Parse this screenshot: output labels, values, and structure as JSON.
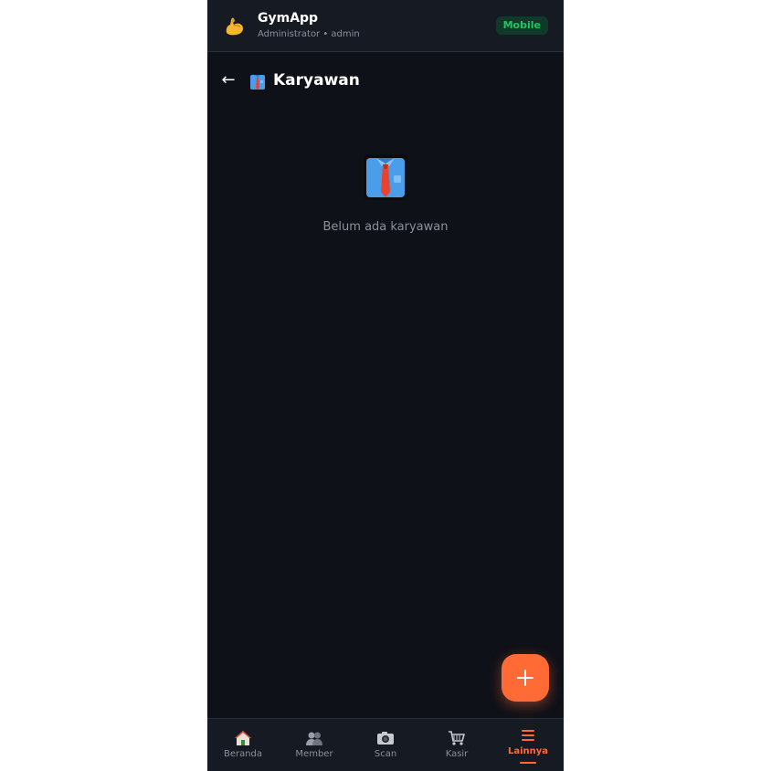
{
  "header": {
    "app_name": "GymApp",
    "user_line": "Administrator • admin",
    "mode_badge": "Mobile",
    "logo_icon": "flexed-biceps-icon"
  },
  "page": {
    "back_label": "←",
    "title": "Karyawan",
    "title_icon": "shirt-tie-icon"
  },
  "empty_state": {
    "icon": "shirt-tie-icon",
    "message": "Belum ada karyawan"
  },
  "fab": {
    "icon": "plus-icon"
  },
  "bottom_nav": {
    "items": [
      {
        "label": "Beranda",
        "icon": "house-icon",
        "active": false
      },
      {
        "label": "Member",
        "icon": "people-icon",
        "active": false
      },
      {
        "label": "Scan",
        "icon": "camera-icon",
        "active": false
      },
      {
        "label": "Kasir",
        "icon": "cart-icon",
        "active": false
      },
      {
        "label": "Lainnya",
        "icon": "menu-icon",
        "active": true
      }
    ]
  },
  "colors": {
    "background": "#0f1118",
    "surface": "#161a22",
    "accent": "#ff6a35",
    "badge_text": "#22c55e",
    "muted_text": "#8a909c"
  }
}
